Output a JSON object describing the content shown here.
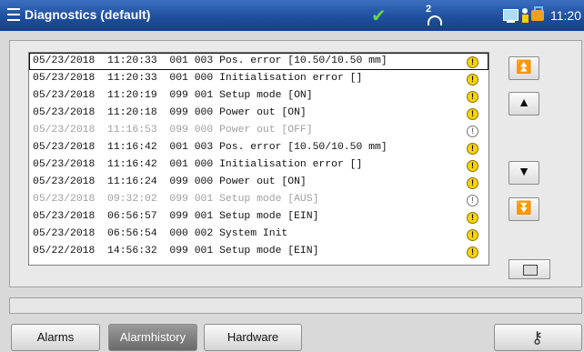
{
  "titlebar": {
    "title": "Diagnostics (default)",
    "status_check_icon": "checkmark-icon",
    "user_level": "2",
    "time": "11:20",
    "colors": {
      "bar": "#1f4f9e",
      "check": "#6ad14a"
    }
  },
  "alarm_history": {
    "columns": [
      "date",
      "time",
      "code",
      "message"
    ],
    "rows": [
      {
        "text": "05/23/2018  11:20:33  001 003 Pos. error [10.50/10.50 mm]",
        "active": true,
        "selected": true
      },
      {
        "text": "05/23/2018  11:20:33  001 000 Initialisation error []",
        "active": true
      },
      {
        "text": "05/23/2018  11:20:19  099 001 Setup mode [ON]",
        "active": true
      },
      {
        "text": "05/23/2018  11:20:18  099 000 Power out [ON]",
        "active": true
      },
      {
        "text": "05/23/2018  11:16:53  099 000 Power out [OFF]",
        "active": false
      },
      {
        "text": "05/23/2018  11:16:42  001 003 Pos. error [10.50/10.50 mm]",
        "active": true
      },
      {
        "text": "05/23/2018  11:16:42  001 000 Initialisation error []",
        "active": true
      },
      {
        "text": "05/23/2018  11:16:24  099 000 Power out [ON]",
        "active": true
      },
      {
        "text": "05/23/2018  09:32:02  099 001 Setup mode [AUS]",
        "active": false
      },
      {
        "text": "05/23/2018  06:56:57  099 001 Setup mode [EIN]",
        "active": true
      },
      {
        "text": "05/23/2018  06:56:54  000 002 System Init",
        "active": true
      },
      {
        "text": "05/22/2018  14:56:32  099 001 Setup mode [EIN]",
        "active": true
      }
    ],
    "warning_glyph": "!"
  },
  "scroll_buttons": {
    "first": "⏫",
    "up": "▲",
    "down": "▼",
    "last": "⏬"
  },
  "tabs": [
    {
      "label": "Alarms",
      "active": false
    },
    {
      "label": "Alarmhistory",
      "active": true
    },
    {
      "label": "Hardware",
      "active": false
    }
  ]
}
